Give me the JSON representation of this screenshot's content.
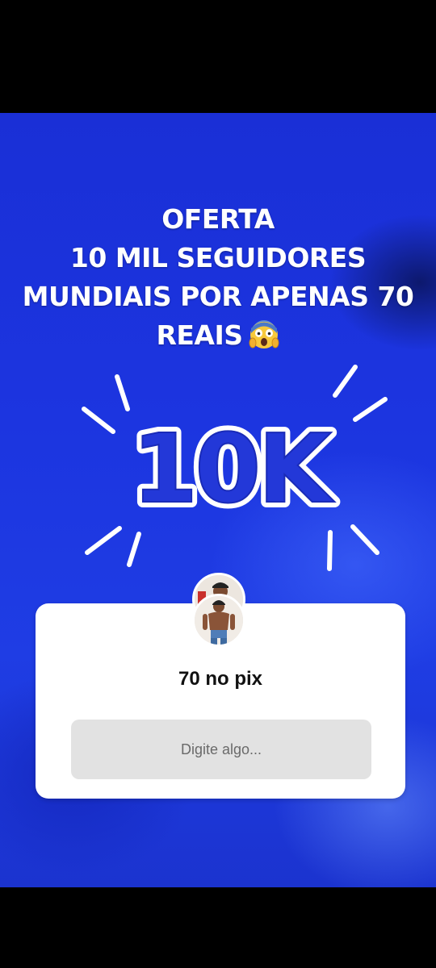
{
  "story": {
    "headline_lines": [
      "OFERTA",
      "10 MIL SEGUIDORES",
      "MUNDIAIS POR APENAS 70",
      "REAIS"
    ],
    "headline_emoji": "face-screaming-in-fear-icon",
    "graphic_text": "10K",
    "colors": {
      "background": "#1c35e0",
      "text": "#ffffff"
    }
  },
  "question_sticker": {
    "question": "70 no pix",
    "answer_placeholder": "Digite algo..."
  }
}
